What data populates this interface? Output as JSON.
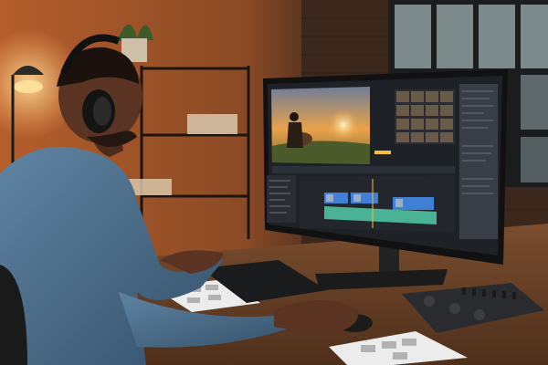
{
  "scene": {
    "subject": "video-editor-at-desk",
    "monitor_app": "video-editing-software",
    "colors": {
      "wall_warm": "#c06a34",
      "wall_dark": "#3a2419",
      "desk": "#6b4328",
      "shirt": "#4d6f8a",
      "skin": "#5a3322",
      "screen_bg": "#1e2126",
      "sunset": "#f2a23a",
      "waveform": "#4fc3a1",
      "clip_blue": "#3f7fd6",
      "lamp_glow": "#ffd27a"
    }
  }
}
